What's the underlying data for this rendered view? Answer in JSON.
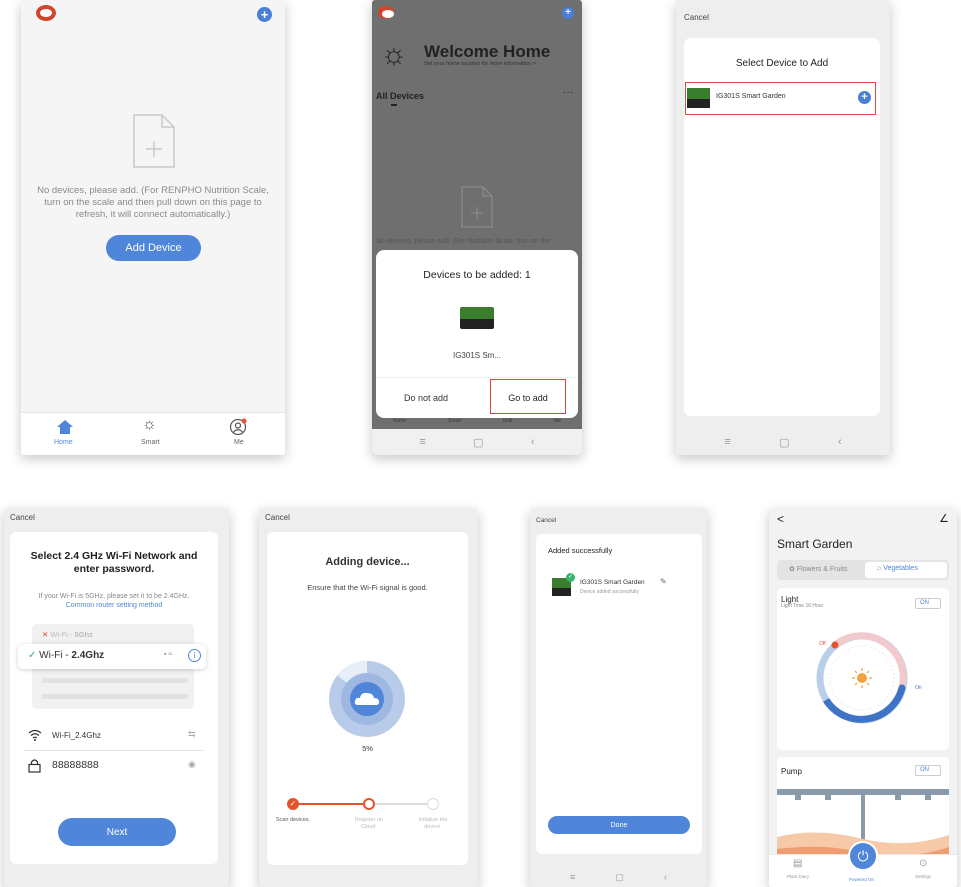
{
  "s1": {
    "empty_text": "No devices, please add. (For RENPHO Nutrition Scale, turn on the scale and then pull down on this page to refresh, it will connect automatically.)",
    "add_device": "Add Device",
    "tabs": [
      "Home",
      "Smart",
      "Me"
    ]
  },
  "s2": {
    "welcome_title": "Welcome Home",
    "welcome_sub": "Set your home location for more information >",
    "all_devices": "All Devices",
    "more": "···",
    "empty_text": "No devices, please add. (For Nutrition Scale, turn on the",
    "sheet_title": "Devices to be added: 1",
    "device_label": "IG301S Sm...",
    "do_not_add": "Do not add",
    "go_to_add": "Go to add",
    "tabs": [
      "Home",
      "Smart",
      "Mall",
      "Me"
    ]
  },
  "s3": {
    "cancel": "Cancel",
    "title": "Select Device to Add",
    "device": "IG301S Smart Garden"
  },
  "s4": {
    "cancel": "Cancel",
    "title": "Select 2.4 GHz Wi-Fi Network and enter password.",
    "hint": "If your Wi-Fi is 5GHz, please set it to be 2.4GHz.",
    "link": "Common router setting method",
    "wifi_5g_prefix": "Wi-Fi - ",
    "wifi_5g": "5Ghz",
    "wifi_24_prefix": "Wi-Fi - ",
    "wifi_24": "2.4Ghz",
    "ssid": "Wi-Fi_2.4Ghz",
    "password": "88888888",
    "next": "Next"
  },
  "s5": {
    "cancel": "Cancel",
    "title": "Adding device...",
    "subtitle": "Ensure that the Wi-Fi signal is good.",
    "percent": "5%",
    "steps": [
      "Scan devices.",
      "Register on Cloud.",
      "Initialize the device."
    ]
  },
  "s6": {
    "cancel": "Cancel",
    "title": "Added successfully",
    "device": "IG301S Smart Garden",
    "status": "Device added successfully",
    "done": "Done"
  },
  "s7": {
    "back": "<",
    "title": "Smart Garden",
    "seg_flowers": "Flowers & Fruits",
    "seg_veg": "Vegetables",
    "light": "Light",
    "light_sub": "Light Time 16 Hour",
    "on": "ON",
    "off_label": "Off",
    "on_label": "On",
    "pump": "Pump",
    "tabs": [
      "Plant Diary",
      "Powered On",
      "Settings"
    ]
  },
  "colors": {
    "accent": "#4f86d9",
    "orange": "#e4542c",
    "red": "#d94a3a",
    "green": "#35b56b"
  }
}
